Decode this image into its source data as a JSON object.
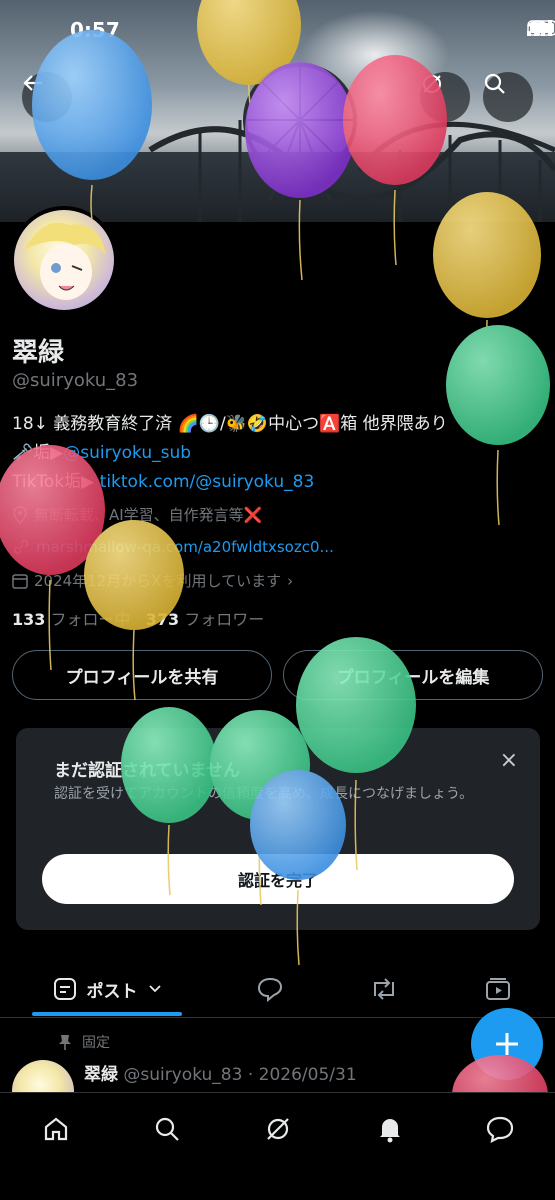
{
  "status_bar": {
    "time": "0:57"
  },
  "profile": {
    "name": "翠緑",
    "handle": "@suiryoku_83",
    "bio_line1": "18↓ 義務教育終了済 🌈🕒/🐝🤣中心つ🅰️箱 他界隈あり",
    "bio_line2_prefix": "🗝️垢▶",
    "bio_line2_link": "@suiryoku_sub",
    "bio_line3_prefix": "TikTok垢▶",
    "bio_line3_link": "tiktok.com/@suiryoku_83",
    "location": "無断転載、AI学習、自作発言等❌",
    "website": "marshmallow-qa.com/a20fwldtxsozc0...",
    "joined": "2024年12月からXを利用しています",
    "following_count": "133",
    "following_label": "フォロー中",
    "followers_count": "373",
    "followers_label": "フォロワー"
  },
  "buttons": {
    "share_profile": "プロフィールを共有",
    "edit_profile": "プロフィールを編集"
  },
  "verify_card": {
    "title": "まだ認証されていません",
    "text": "認証を受けてアカウントの信頼度を高め、成長につなげましょう。",
    "button": "認証を完了",
    "close": "×"
  },
  "tabs": {
    "posts": "ポスト"
  },
  "pinned_post": {
    "pinned_label": "固定",
    "author": "翠緑",
    "meta": "@suiryoku_83 · 2026/05/31"
  },
  "icons": {
    "back": "back-arrow-icon",
    "grok": "grok-icon",
    "search": "search-icon",
    "home": "home-icon",
    "notifications": "bell-icon",
    "messages": "messages-icon",
    "compose": "plus-icon"
  },
  "colors": {
    "accent": "#1d9bf0",
    "background": "#000000",
    "card": "#202327",
    "muted": "#71767b"
  }
}
